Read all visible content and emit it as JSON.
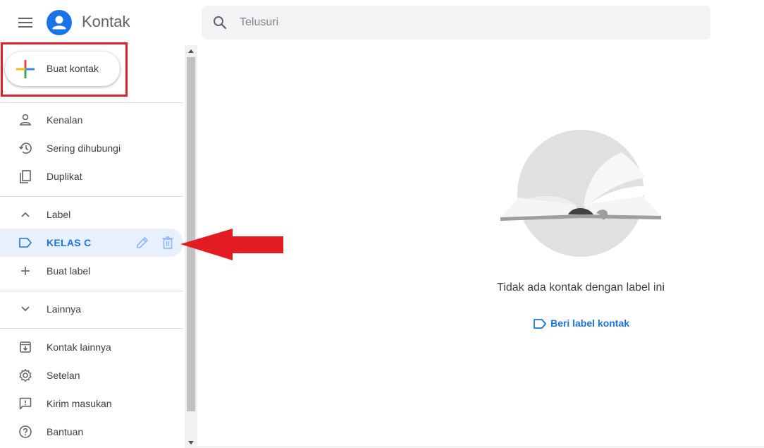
{
  "app": {
    "title": "Kontak",
    "brand_color": "#1a73e8"
  },
  "header": {
    "menu_icon": "hamburger-menu-icon",
    "logo_icon": "contacts-person-icon",
    "search": {
      "icon": "search-icon",
      "placeholder": "Telusuri",
      "value": ""
    }
  },
  "sidebar": {
    "create_button": {
      "label": "Buat kontak",
      "icon": "multicolor-plus-icon"
    },
    "main_items": [
      {
        "label": "Kenalan",
        "icon": "person-icon"
      },
      {
        "label": "Sering dihubungi",
        "icon": "history-icon"
      },
      {
        "label": "Duplikat",
        "icon": "copy-icon"
      }
    ],
    "label_section": {
      "header": "Label",
      "icon": "chevron-up-icon",
      "items": [
        {
          "label": "KELAS C",
          "icon": "label-tag-icon",
          "active": true,
          "edit_icon": "pencil-icon",
          "delete_icon": "trash-icon"
        }
      ],
      "create_label": {
        "label": "Buat label",
        "icon": "plus-icon"
      }
    },
    "more": {
      "label": "Lainnya",
      "icon": "chevron-down-icon"
    },
    "footer_items": [
      {
        "label": "Kontak lainnya",
        "icon": "archive-download-icon"
      },
      {
        "label": "Setelan",
        "icon": "gear-icon"
      },
      {
        "label": "Kirim masukan",
        "icon": "feedback-icon"
      },
      {
        "label": "Bantuan",
        "icon": "help-icon"
      }
    ],
    "active_color": "#e8f0fe"
  },
  "main": {
    "empty_state": {
      "illustration": "open-book-illustration",
      "message": "Tidak ada kontak dengan label ini",
      "action_label": "Beri label kontak",
      "action_icon": "label-tag-icon"
    }
  },
  "annotations": {
    "highlight_color": "#e0202a",
    "arrow": "red-left-arrow"
  }
}
